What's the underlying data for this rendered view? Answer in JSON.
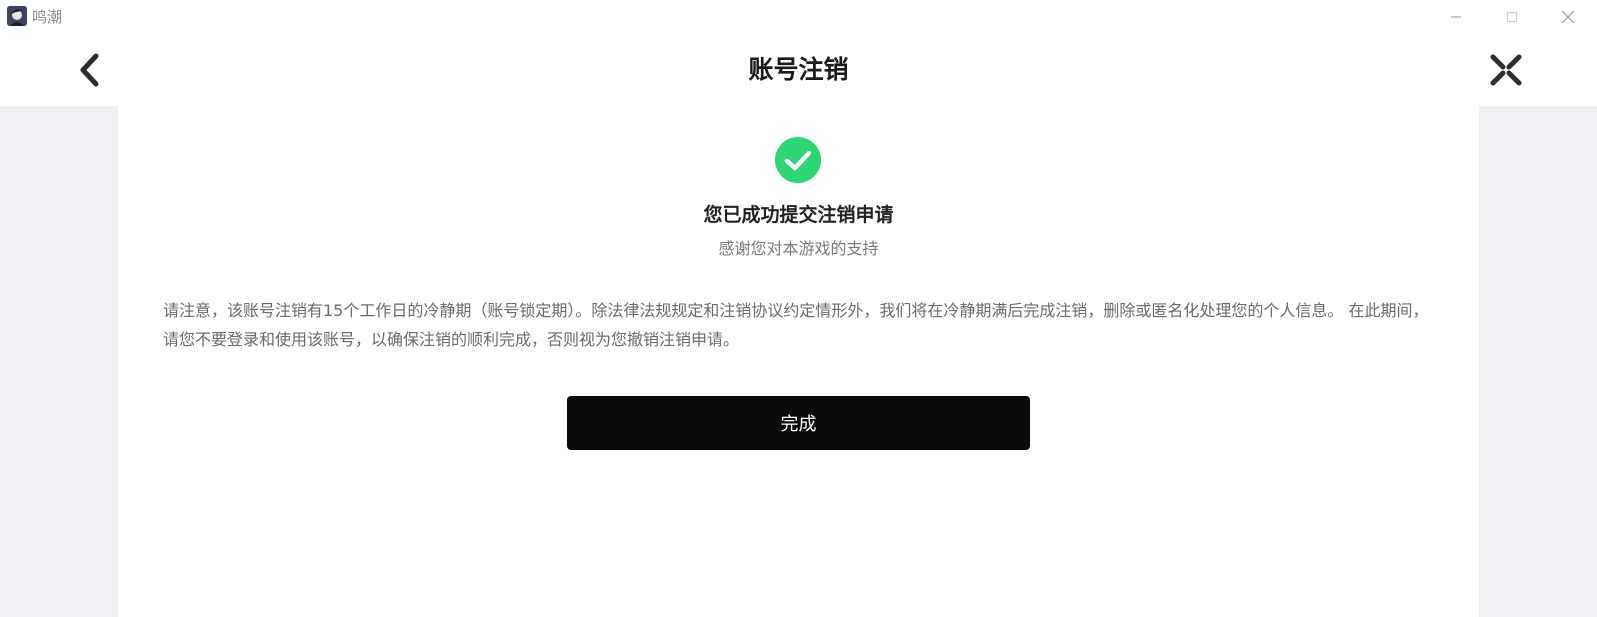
{
  "window": {
    "title": "鸣潮",
    "app_icon": "game-avatar-icon",
    "controls": [
      "minimize-icon",
      "maximize-icon",
      "close-icon"
    ]
  },
  "header": {
    "title": "账号注销",
    "back_icon": "chevron-left-icon",
    "close_icon": "close-x-icon"
  },
  "result": {
    "icon": "check-circle-icon",
    "title": "您已成功提交注销申请",
    "subtitle": "感谢您对本游戏的支持",
    "notice": "请注意，该账号注销有15个工作日的冷静期（账号锁定期）。除法律法规规定和注销协议约定情形外，我们将在冷静期满后完成注销，删除或匿名化处理您的个人信息。 在此期间，请您不要登录和使用该账号，以确保注销的顺利完成，否则视为您撤销注销申请。"
  },
  "actions": {
    "done_label": "完成"
  },
  "colors": {
    "success_green": "#2ed573",
    "button_bg": "#0c0c0c",
    "backdrop": "#f1f1f5"
  }
}
